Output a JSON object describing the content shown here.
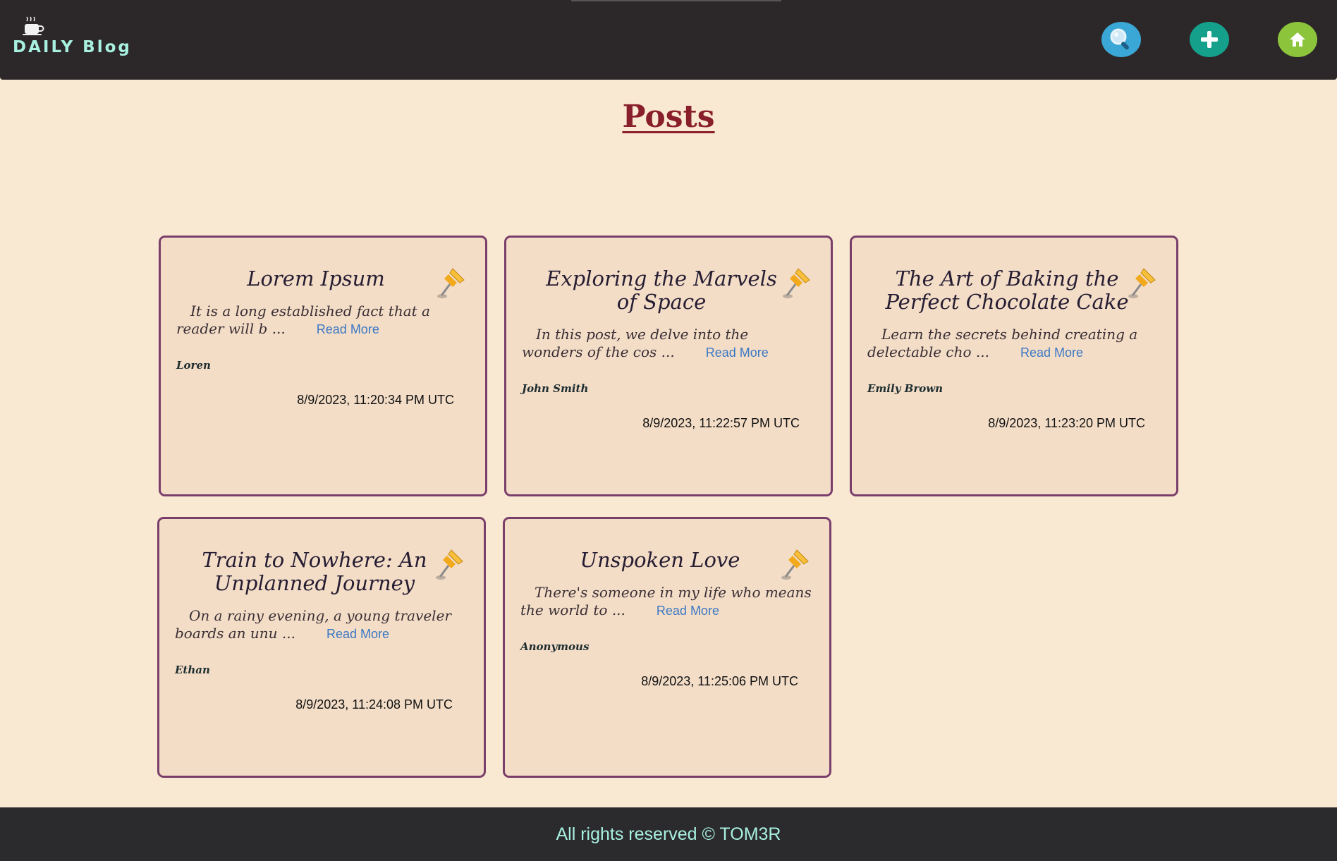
{
  "header": {
    "brand": "DAILY Blog",
    "actions": {
      "search_icon": "magnifier-icon",
      "add_icon": "plus-icon",
      "home_icon": "home-icon"
    },
    "colors": {
      "bar": "#2c2729",
      "brand_text": "#a8f0df",
      "search": "#3ba7d6",
      "add": "#15a08c",
      "home": "#8cc43c"
    }
  },
  "main": {
    "title": "Posts",
    "posts": [
      {
        "title": "Lorem Ipsum",
        "excerpt": "It is a long established fact that a reader will b ...",
        "read_more": "Read More",
        "author": "Loren",
        "date": "8/9/2023, 11:20:34 PM UTC"
      },
      {
        "title": "Exploring the Marvels of Space",
        "excerpt": "In this post, we delve into the wonders of the cos ...",
        "read_more": "Read More",
        "author": "John Smith",
        "date": "8/9/2023, 11:22:57 PM UTC"
      },
      {
        "title": "The Art of Baking the Perfect Chocolate Cake",
        "excerpt": "Learn the secrets behind creating a delectable cho ...",
        "read_more": "Read More",
        "author": "Emily Brown",
        "date": "8/9/2023, 11:23:20 PM UTC"
      },
      {
        "title": "Train to Nowhere: An Unplanned Journey",
        "excerpt": "On a rainy evening, a young traveler boards an unu ...",
        "read_more": "Read More",
        "author": "Ethan",
        "date": "8/9/2023, 11:24:08 PM UTC"
      },
      {
        "title": "Unspoken Love",
        "excerpt": "There's someone in my life who means the world to ...",
        "read_more": "Read More",
        "author": "Anonymous",
        "date": "8/9/2023, 11:25:06 PM UTC"
      }
    ]
  },
  "footer": {
    "text": "All rights reserved © TOM3R"
  }
}
